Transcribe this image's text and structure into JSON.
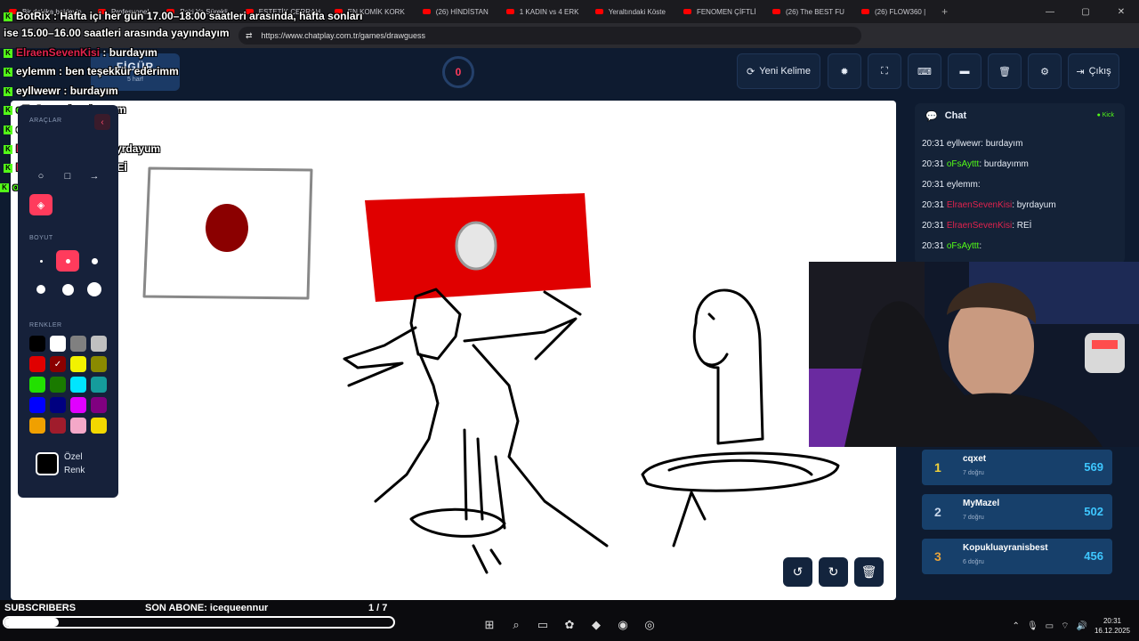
{
  "browser": {
    "tabs": [
      {
        "label": "Bir dakika bekleyin"
      },
      {
        "label": "Profesyonel"
      },
      {
        "label": "Peki Ya Sürekli"
      },
      {
        "label": "ESTETİK CERRAH"
      },
      {
        "label": "EN KOMİK KORK"
      },
      {
        "label": "(26) HİNDİSTAN"
      },
      {
        "label": "1 KADIN vs 4 ERK"
      },
      {
        "label": "Yeraltındaki Köste"
      },
      {
        "label": "FENOMEN ÇİFTLİ"
      },
      {
        "label": "(26) The BEST FU"
      },
      {
        "label": "(26) FLOW360 |"
      }
    ],
    "url": "https://www.chatplay.com.tr/games/drawguess"
  },
  "game": {
    "word": "FİGÜR",
    "hint": "5 harf",
    "timer": "0",
    "new_word_label": "Yeni Kelime",
    "exit_label": "Çıkış"
  },
  "tools": {
    "tools_label": "ARAÇLAR",
    "size_label": "BOYUT",
    "colors_label": "RENKLER",
    "custom_line1": "Özel",
    "custom_line2": "Renk",
    "palette": [
      "#000000",
      "#ffffff",
      "#808080",
      "#c0c0c0",
      "#e00000",
      "#8b0000",
      "#f2f200",
      "#8a8a00",
      "#22e000",
      "#1a7a00",
      "#00e5ff",
      "#159c9c",
      "#0000ff",
      "#000080",
      "#e100ff",
      "#800080",
      "#f0a000",
      "#a01c2c",
      "#f4a8c8",
      "#f2d800"
    ]
  },
  "chat": {
    "title": "Chat",
    "platform": "Kick",
    "messages": [
      {
        "time": "20:31",
        "user": "eyllwewr",
        "text": "burdayım"
      },
      {
        "time": "20:31",
        "user": "oFsAyttt",
        "text": "burdayımm"
      },
      {
        "time": "20:31",
        "user": "eylemm",
        "text": ""
      },
      {
        "time": "20:31",
        "user": "ElraenSevenKisi",
        "text": "byrdayum"
      },
      {
        "time": "20:31",
        "user": "ElraenSevenKisi",
        "text": "REİ"
      },
      {
        "time": "20:31",
        "user": "oFsAyttt",
        "text": ""
      }
    ]
  },
  "leaderboard": [
    {
      "rank": "1",
      "name": "cqxet",
      "sub": "7 doğru",
      "score": "569"
    },
    {
      "rank": "2",
      "name": "MyMazel",
      "sub": "7 doğru",
      "score": "502"
    },
    {
      "rank": "3",
      "name": "Kopukluayranisbest",
      "sub": "6 doğru",
      "score": "456"
    }
  ],
  "overlay_chat": [
    {
      "user": "BotRix",
      "text": "Hafta içi her gün 17.00–18.00 saatleri arasında, hafta sonları"
    },
    {
      "user": "",
      "text": "ise 15.00–16.00 saatleri arasında yayındayım"
    },
    {
      "user": "ElraenSevenKisi",
      "text": "burdayım"
    },
    {
      "user": "eylemm",
      "text": "ben teşekkür ederimm"
    },
    {
      "user": "eyllwewr",
      "text": "burdayım"
    },
    {
      "user": "oFsAyttt",
      "text": "burdayımm"
    },
    {
      "user": "eylemm",
      "text": ""
    },
    {
      "user": "ElraenSevenKisi",
      "text": "byrdayum"
    },
    {
      "user": "ElraenSevenKisi",
      "text": "REİ"
    },
    {
      "user": "oFsAyttt",
      "text": ""
    }
  ],
  "overlay_bottom": {
    "subscribers": "SUBSCRIBERS",
    "last_sub": "SON ABONE: icequeennur",
    "page": "1 / 7",
    "progress": 0.14
  },
  "system": {
    "time": "20:31",
    "date": "16.12.2025"
  }
}
